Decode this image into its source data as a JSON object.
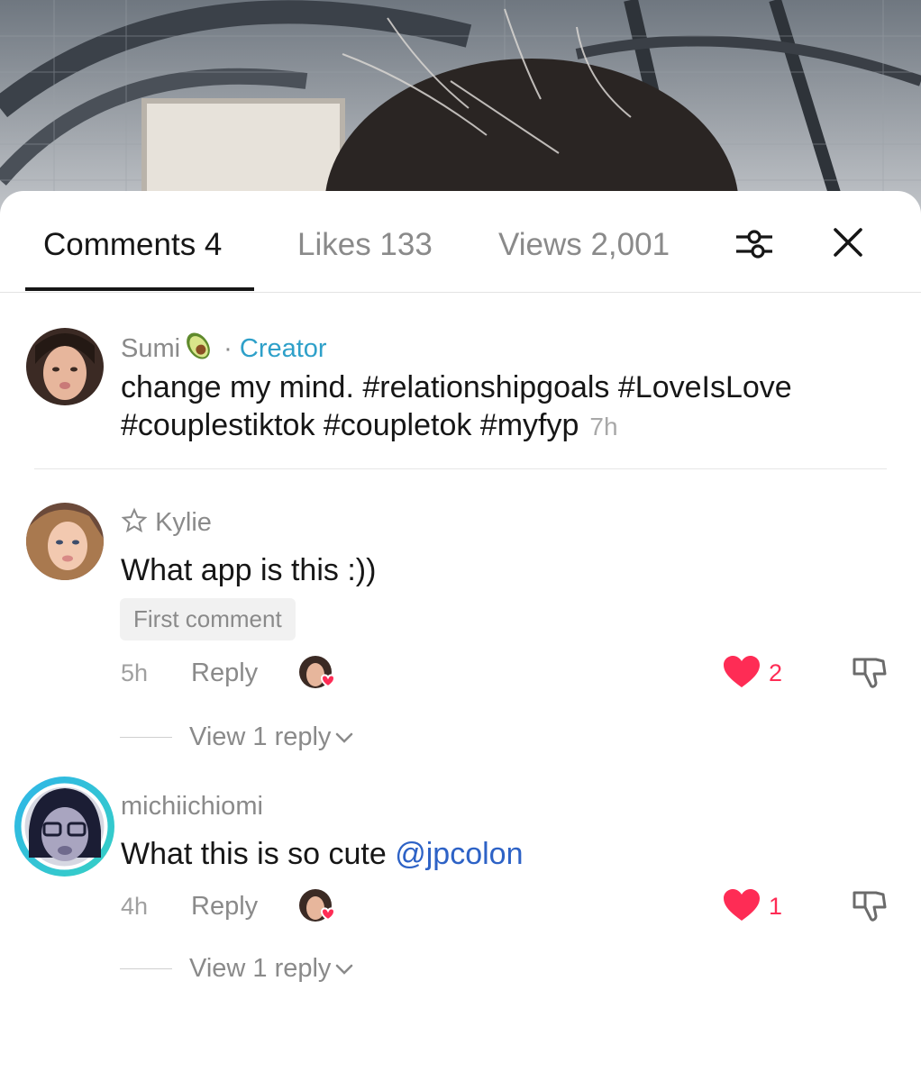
{
  "tabs": {
    "comments": "Comments 4",
    "likes": "Likes 133",
    "views": "Views 2,001",
    "filter_icon": "sliders-icon",
    "close_icon": "close-icon"
  },
  "comments": [
    {
      "username": "Sumi",
      "username_emoji": "avocado",
      "separator": "·",
      "role": "Creator",
      "text_plain": "change my mind.",
      "hashtags_line1": "#relationshipgoals #LoveIsLove",
      "hashtags_line2": "#couplestiktok #coupletok #myfyp",
      "time": "7h"
    },
    {
      "username": "Kylie",
      "username_icon": "star-outline-icon",
      "text": "What app is this :))",
      "badge": "First comment",
      "time": "5h",
      "reply_label": "Reply",
      "likes": "2",
      "view_replies": "View 1 reply"
    },
    {
      "username": "michiichiomi",
      "text": "What this is so cute",
      "mention": "@jpcolon",
      "time": "4h",
      "reply_label": "Reply",
      "likes": "1",
      "view_replies": "View 1 reply"
    }
  ],
  "colors": {
    "accent_like": "#fe2c55",
    "creator": "#2ea0c9",
    "mention": "#2d62c6",
    "text_primary": "#161616",
    "text_secondary": "#8a8a8a"
  }
}
